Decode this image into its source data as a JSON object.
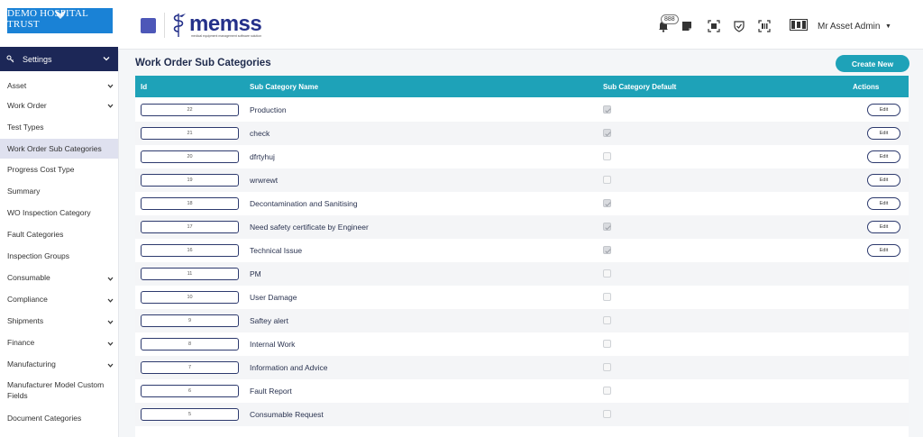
{
  "header": {
    "trust_name": "DEMO HOSPITAL TRUST",
    "brand": "memss",
    "brand_tagline": "medical equipment management software solution",
    "notification_count": "888",
    "user_name": "Mr Asset Admin"
  },
  "sidebar": {
    "settings_label": "Settings",
    "items": [
      {
        "label": "Asset"
      },
      {
        "label": "Work Order"
      },
      {
        "label": "Test Types"
      },
      {
        "label": "Work Order Sub Categories"
      },
      {
        "label": "Progress Cost Type"
      },
      {
        "label": "Summary"
      },
      {
        "label": "WO Inspection Category"
      },
      {
        "label": "Fault Categories"
      },
      {
        "label": "Inspection Groups"
      },
      {
        "label": "Consumable"
      },
      {
        "label": "Compliance"
      },
      {
        "label": "Shipments"
      },
      {
        "label": "Finance"
      },
      {
        "label": "Manufacturing"
      },
      {
        "label": "Manufacturer Model Custom Fields"
      },
      {
        "label": "Document Categories"
      }
    ]
  },
  "main": {
    "title": "Work Order Sub Categories",
    "create_label": "Create New",
    "columns": {
      "id": "Id",
      "name": "Sub Category Name",
      "default": "Sub Category Default",
      "actions": "Actions"
    },
    "edit_label": "Edit",
    "rows": [
      {
        "id": "22",
        "name": "Production",
        "default": true,
        "editable": true
      },
      {
        "id": "21",
        "name": "check",
        "default": true,
        "editable": true
      },
      {
        "id": "20",
        "name": "dfrtyhuj",
        "default": false,
        "editable": true
      },
      {
        "id": "19",
        "name": "wrwrewt",
        "default": false,
        "editable": true
      },
      {
        "id": "18",
        "name": "Decontamination and Sanitising",
        "default": true,
        "editable": true
      },
      {
        "id": "17",
        "name": "Need safety certificate by Engineer",
        "default": true,
        "editable": true
      },
      {
        "id": "16",
        "name": "Technical Issue",
        "default": true,
        "editable": true
      },
      {
        "id": "11",
        "name": "PM",
        "default": false,
        "editable": false
      },
      {
        "id": "10",
        "name": "User Damage",
        "default": false,
        "editable": false
      },
      {
        "id": "9",
        "name": "Saftey alert",
        "default": false,
        "editable": false
      },
      {
        "id": "8",
        "name": "Internal Work",
        "default": false,
        "editable": false
      },
      {
        "id": "7",
        "name": "Information and Advice",
        "default": false,
        "editable": false
      },
      {
        "id": "6",
        "name": "Fault Report",
        "default": false,
        "editable": false
      },
      {
        "id": "5",
        "name": "Consumable Request",
        "default": false,
        "editable": false
      }
    ]
  },
  "colors": {
    "accent": "#1ea2b8",
    "sidebar_active_header": "#1c2757",
    "brand_blue": "#24308a",
    "trust_blue": "#1a82d6"
  },
  "icons": {
    "notification": "bell-icon",
    "notes": "sticky-note-icon",
    "scan1": "qr-scan-icon",
    "shield": "shield-icon",
    "scan2": "barcode-scan-icon"
  }
}
